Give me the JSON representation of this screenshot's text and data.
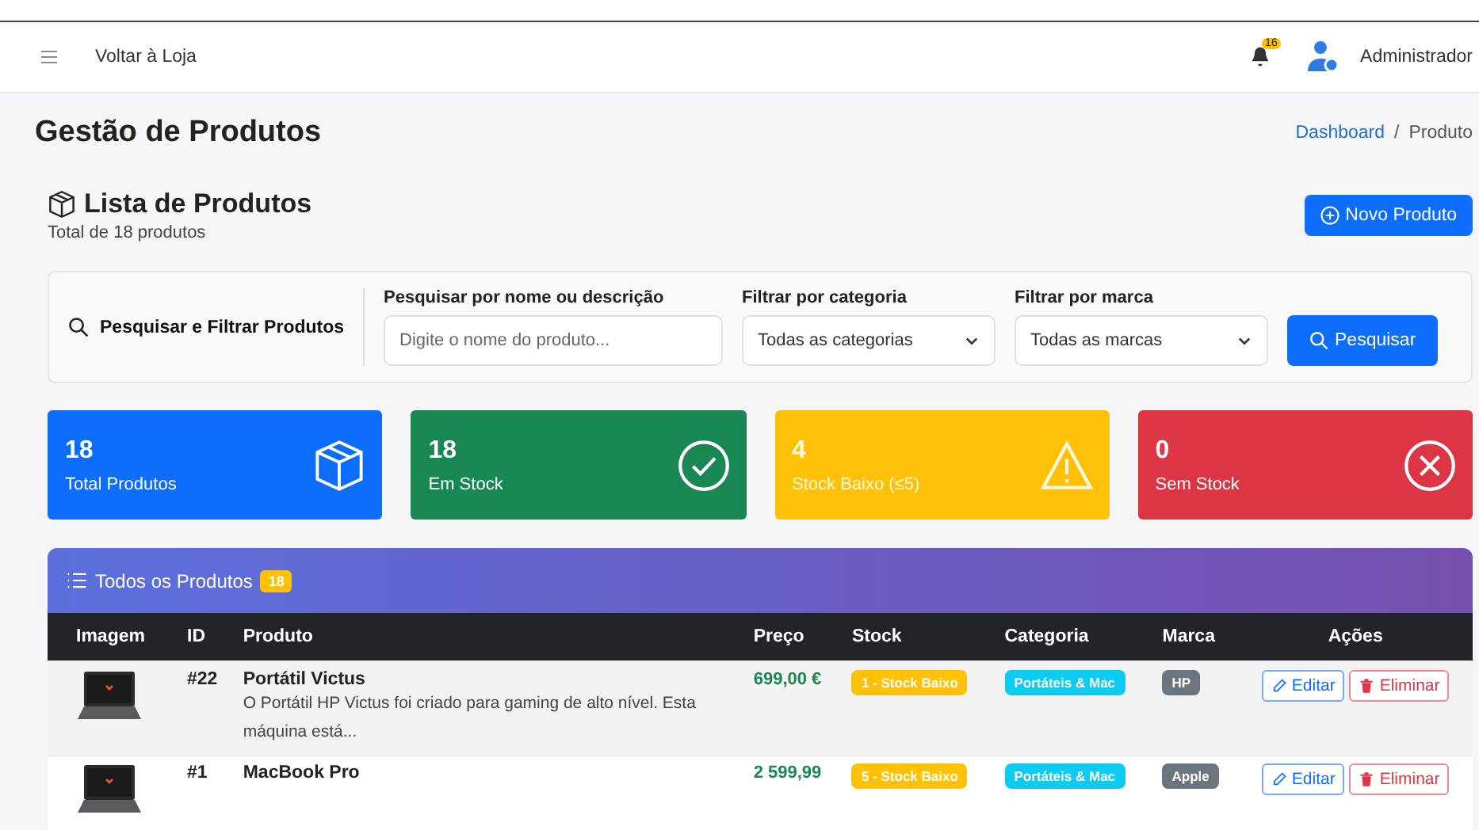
{
  "navbar": {
    "back_link": "Voltar à Loja",
    "notification_count": "16",
    "user": "Administrador"
  },
  "page": {
    "title": "Gestão de Produtos",
    "breadcrumb_separator": "/",
    "breadcrumb": [
      {
        "label": "Dashboard",
        "link": true
      },
      {
        "label": "Produto",
        "link": false
      }
    ]
  },
  "list_header": {
    "title": "Lista de Produtos",
    "subtitle": "Total de 18 produtos",
    "new_button": "Novo Produto"
  },
  "filters": {
    "title": "Pesquisar e Filtrar Produtos",
    "search_label": "Pesquisar por nome ou descrição",
    "search_placeholder": "Digite o nome do produto...",
    "category_label": "Filtrar por categoria",
    "category_value": "Todas as categorias",
    "brand_label": "Filtrar por marca",
    "brand_value": "Todas as marcas",
    "search_button": "Pesquisar"
  },
  "stats": [
    {
      "kind": "box",
      "value": "18",
      "label": "Total Produtos",
      "color": "#0d6efd"
    },
    {
      "kind": "check",
      "value": "18",
      "label": "Em Stock",
      "color": "#198754"
    },
    {
      "kind": "warning",
      "value": "4",
      "label": "Stock Baixo (≤5)",
      "color": "#ffc107"
    },
    {
      "kind": "cross",
      "value": "0",
      "label": "Sem Stock",
      "color": "#dc3545"
    }
  ],
  "table": {
    "title": "Todos os Produtos",
    "count": "18",
    "columns": [
      "Imagem",
      "ID",
      "Produto",
      "Preço",
      "Stock",
      "Categoria",
      "Marca",
      "Ações"
    ],
    "rows": [
      {
        "id": "#22",
        "name": "Portátil Victus",
        "description": "O Portátil HP Victus foi criado para gaming de alto nível. Esta máquina está...",
        "price": "699,00 €",
        "stock": "1 - Stock Baixo",
        "category": "Portáteis & Mac",
        "brand": "HP",
        "edit": "Editar",
        "delete": "Eliminar"
      },
      {
        "id": "#1",
        "name": "MacBook Pro",
        "price": "2 599,99",
        "stock": "5 - Stock Baixo",
        "category": "Portáteis & Mac",
        "brand": "Apple",
        "edit": "Editar",
        "delete": "Eliminar"
      }
    ]
  }
}
